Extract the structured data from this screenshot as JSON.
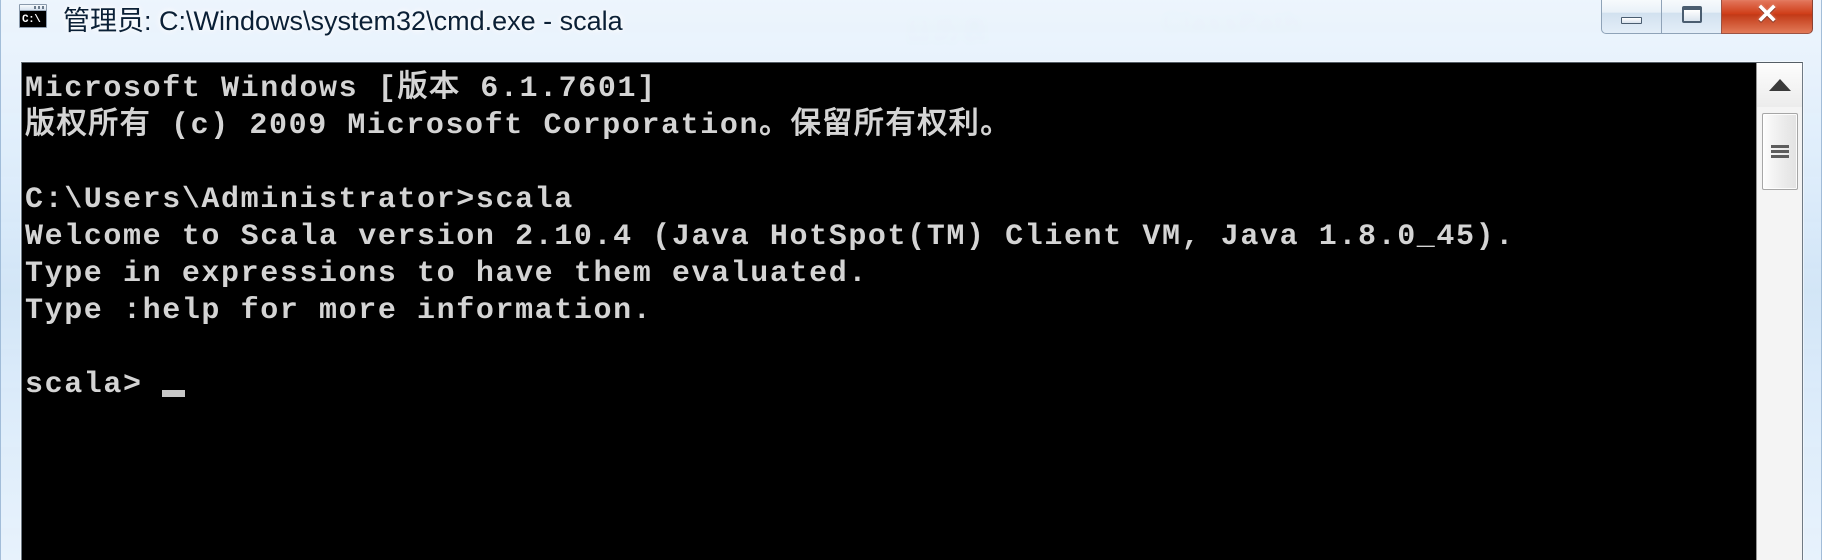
{
  "window": {
    "title": "管理员: C:\\Windows\\system32\\cmd.exe - scala",
    "icon_name": "cmd-exe-icon",
    "icon_text": "C:\\",
    "caption": {
      "minimize_label": "—",
      "maximize_label": "□",
      "close_label": "✕"
    }
  },
  "background": {
    "ghost_text_1": "日历表",
    "ghost_text_2": "ClassPath"
  },
  "console": {
    "lines": [
      "Microsoft Windows [版本 6.1.7601]",
      "版权所有 (c) 2009 Microsoft Corporation。保留所有权利。",
      "",
      "C:\\Users\\Administrator>scala",
      "Welcome to Scala version 2.10.4 (Java HotSpot(TM) Client VM, Java 1.8.0_45).",
      "Type in expressions to have them evaluated.",
      "Type :help for more information.",
      ""
    ],
    "prompt": "scala>",
    "cursor": "_"
  },
  "scrollbar": {
    "up_arrow": "▲",
    "thumb_grip": "grip"
  },
  "colors": {
    "console_background": "#000000",
    "console_text": "#d4d4d4",
    "close_button": "#c23a17",
    "title_text": "#0b2036",
    "aero_glass": "#dceaf8"
  }
}
